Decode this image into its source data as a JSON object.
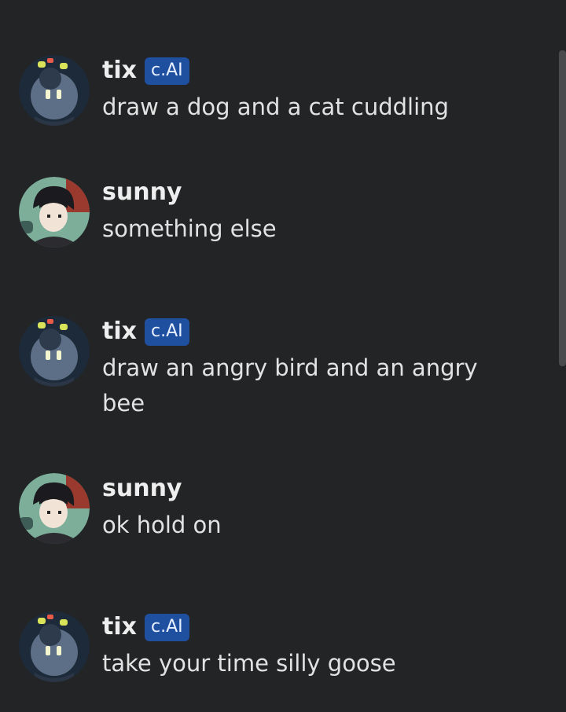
{
  "messages": [
    {
      "author": "tix",
      "badge": "c.AI",
      "text": "draw a dog and a cat cuddling",
      "avatar": "robot-avatar"
    },
    {
      "author": "sunny",
      "badge": "",
      "text": "something else",
      "avatar": "boy-avatar"
    },
    {
      "author": "tix",
      "badge": "c.AI",
      "text": "draw an angry bird and an angry bee",
      "avatar": "robot-avatar"
    },
    {
      "author": "sunny",
      "badge": "",
      "text": "ok hold on",
      "avatar": "boy-avatar"
    },
    {
      "author": "tix",
      "badge": "c.AI",
      "text": "take your time silly goose",
      "avatar": "robot-avatar"
    }
  ],
  "colors": {
    "background": "#232425",
    "badge": "#1f4f9f",
    "text": "#e2e2e2"
  }
}
